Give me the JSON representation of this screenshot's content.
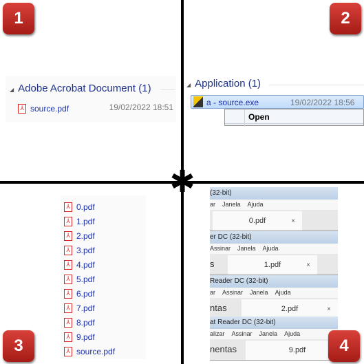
{
  "badges": [
    "1",
    "2",
    "3",
    "4"
  ],
  "q1": {
    "group": "Adobe Acrobat Document (1)",
    "file": "source.pdf",
    "date": "19/02/2022 18:51"
  },
  "q2": {
    "group": "Application (1)",
    "file": "a - source.exe",
    "date": "19/02/2022 18:56",
    "menu_open": "Open"
  },
  "q3": {
    "files": [
      "0.pdf",
      "1.pdf",
      "2.pdf",
      "3.pdf",
      "4.pdf",
      "5.pdf",
      "6.pdf",
      "7.pdf",
      "8.pdf",
      "9.pdf",
      "source.pdf"
    ]
  },
  "q4": {
    "windows": [
      {
        "title": "(32-bit)",
        "menu": [
          "ar",
          "Janela",
          "Ajuda"
        ],
        "left_tab": "",
        "tab": "0.pdf"
      },
      {
        "title": "er DC (32-bit)",
        "menu": [
          "Assinar",
          "Janela",
          "Ajuda"
        ],
        "left_tab": "s",
        "tab": "1.pdf"
      },
      {
        "title": "Reader DC (32-bit)",
        "menu": [
          "ar",
          "Assinar",
          "Janela",
          "Ajuda"
        ],
        "left_tab": "ntas",
        "tab": "2.pdf"
      },
      {
        "title": "at Reader DC (32-bit)",
        "menu": [
          "alizar",
          "Assinar",
          "Janela",
          "Ajuda"
        ],
        "left_tab": "nentas",
        "tab": "9.pdf"
      }
    ],
    "close": "×"
  }
}
